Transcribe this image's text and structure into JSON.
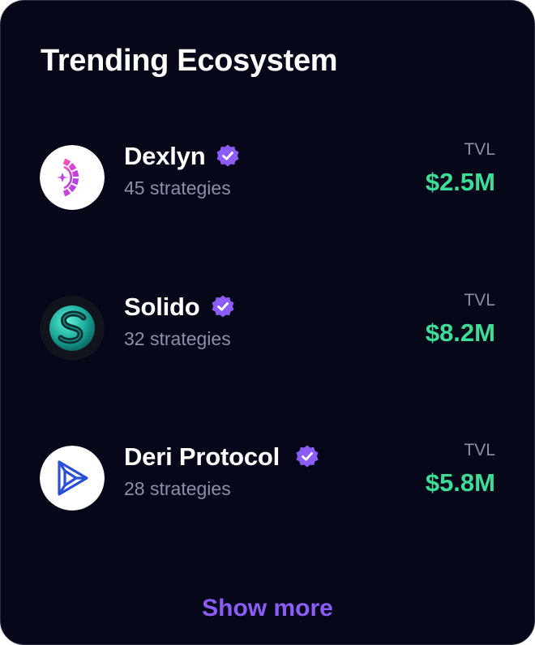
{
  "card": {
    "title": "Trending Ecosystem",
    "show_more_label": "Show more"
  },
  "colors": {
    "background": "#06081a",
    "tvl_value": "#3ddc97",
    "accent": "#8b5cf6",
    "muted_text": "#8b8fa8"
  },
  "ecosystems": [
    {
      "name": "Dexlyn",
      "strategies": "45 strategies",
      "tvl_label": "TVL",
      "tvl_value": "$2.5M",
      "logo_icon": "dexlyn-logo-icon",
      "verified_icon": "verified-badge-icon"
    },
    {
      "name": "Solido",
      "strategies": "32 strategies",
      "tvl_label": "TVL",
      "tvl_value": "$8.2M",
      "logo_icon": "solido-logo-icon",
      "verified_icon": "verified-badge-icon"
    },
    {
      "name": "Deri Protocol",
      "strategies": "28 strategies",
      "tvl_label": "TVL",
      "tvl_value": "$5.8M",
      "logo_icon": "deri-protocol-logo-icon",
      "verified_icon": "verified-badge-icon"
    }
  ]
}
